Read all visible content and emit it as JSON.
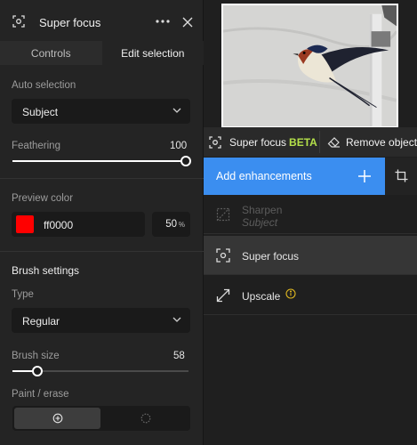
{
  "panel": {
    "title": "Super focus",
    "icons": {
      "title_icon": "super-focus-icon",
      "more": "more-horizontal-icon",
      "close": "close-icon"
    }
  },
  "tabs": [
    {
      "label": "Controls",
      "active": false
    },
    {
      "label": "Edit selection",
      "active": true
    }
  ],
  "auto_selection": {
    "label": "Auto selection",
    "value": "Subject"
  },
  "feathering": {
    "label": "Feathering",
    "value": "100",
    "level": 1.0
  },
  "preview_color": {
    "label": "Preview color",
    "swatch": "#ff0000",
    "hex": "ff0000",
    "opacity": "50",
    "unit": "%"
  },
  "brush": {
    "section_title": "Brush settings",
    "type_label": "Type",
    "type_value": "Regular",
    "size_label": "Brush size",
    "size_value": "58",
    "size_level": 0.14,
    "paint_label": "Paint / erase",
    "modes": [
      {
        "name": "paint",
        "icon": "paint-brush-icon",
        "selected": true
      },
      {
        "name": "erase",
        "icon": "erase-brush-icon",
        "selected": false
      }
    ]
  },
  "right": {
    "toolbar": {
      "super_focus": "Super focus",
      "beta": "BETA",
      "remove_object": "Remove object"
    },
    "add_enhancements": "Add enhancements",
    "enhancements": [
      {
        "name": "Sharpen",
        "sub": "Subject",
        "state": "disabled",
        "icon": "sharpen-icon"
      },
      {
        "name": "Super focus",
        "sub": "",
        "state": "selected",
        "icon": "super-focus-icon"
      },
      {
        "name": "Upscale",
        "sub": "",
        "state": "normal",
        "icon": "upscale-icon"
      }
    ]
  },
  "colors": {
    "accent": "#3b8ef0",
    "beta": "#b4e04a",
    "info": "#e0b820"
  }
}
